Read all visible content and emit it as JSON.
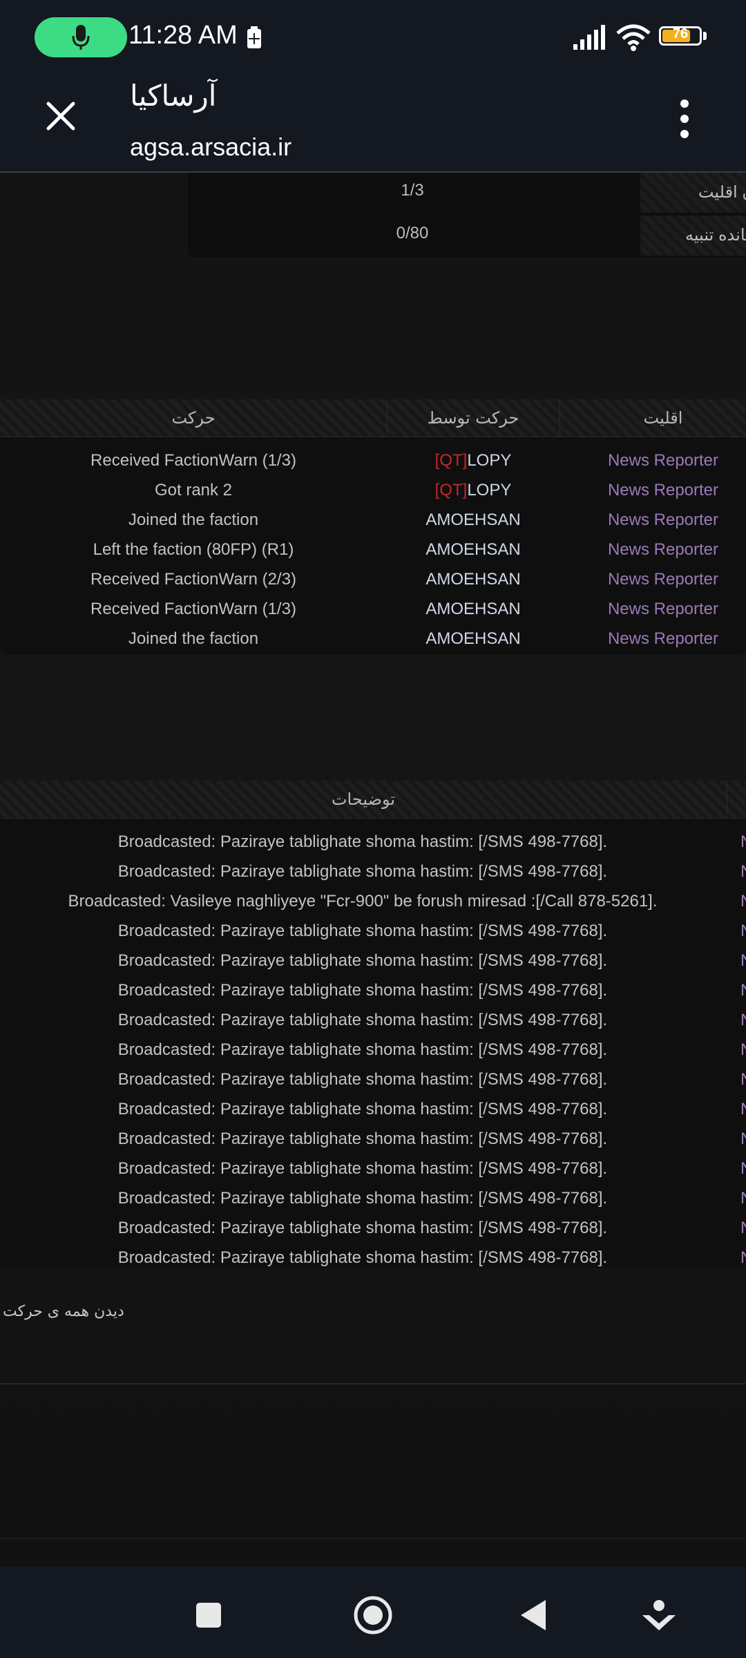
{
  "status_bar": {
    "time": "11:28 AM",
    "battery": "76",
    "battery_level_percent": 76,
    "icons": [
      "microphone-icon",
      "battery-saver-icon",
      "signal-icon",
      "wifi-icon",
      "battery-icon"
    ]
  },
  "header": {
    "title": "آرساکیا",
    "url": "agsa.arsacia.ir",
    "icons": [
      "close-icon",
      "more-vert-icon"
    ]
  },
  "info": {
    "rows": [
      {
        "label": "ن اقلیت",
        "value": "1/3"
      },
      {
        "label": "مانده تنبیه",
        "value": "0/80"
      }
    ]
  },
  "moves_table": {
    "headers": {
      "action": "حرکت",
      "by": "حرکت توسط",
      "rank": "اقلیت"
    },
    "rows": [
      {
        "action": "Received FactionWarn (1/3)",
        "by_tag": "[QT]",
        "by": "LOPY",
        "rank": "News Reporter"
      },
      {
        "action": "Got rank 2",
        "by_tag": "[QT]",
        "by": "LOPY",
        "rank": "News Reporter"
      },
      {
        "action": "Joined the faction",
        "by_tag": "",
        "by": "AMOEHSAN",
        "rank": "News Reporter"
      },
      {
        "action": "Left the faction (80FP) (R1)",
        "by_tag": "",
        "by": "AMOEHSAN",
        "rank": "News Reporter"
      },
      {
        "action": "Received FactionWarn (2/3)",
        "by_tag": "",
        "by": "AMOEHSAN",
        "rank": "News Reporter"
      },
      {
        "action": "Received FactionWarn (1/3)",
        "by_tag": "",
        "by": "AMOEHSAN",
        "rank": "News Reporter"
      },
      {
        "action": "Joined the faction",
        "by_tag": "",
        "by": "AMOEHSAN",
        "rank": "News Reporter"
      }
    ]
  },
  "desc_table": {
    "header": "توضیحات",
    "edge_text": "N",
    "rows": [
      "Broadcasted: Paziraye tablighate shoma hastim: [/SMS 498-7768].",
      "Broadcasted: Paziraye tablighate shoma hastim: [/SMS 498-7768].",
      "Broadcasted: Vasileye naghliyeye \"Fcr-900\" be forush miresad :[/Call 878-5261].",
      "Broadcasted: Paziraye tablighate shoma hastim: [/SMS 498-7768].",
      "Broadcasted: Paziraye tablighate shoma hastim: [/SMS 498-7768].",
      "Broadcasted: Paziraye tablighate shoma hastim: [/SMS 498-7768].",
      "Broadcasted: Paziraye tablighate shoma hastim: [/SMS 498-7768].",
      "Broadcasted: Paziraye tablighate shoma hastim: [/SMS 498-7768].",
      "Broadcasted: Paziraye tablighate shoma hastim: [/SMS 498-7768].",
      "Broadcasted: Paziraye tablighate shoma hastim: [/SMS 498-7768].",
      "Broadcasted: Paziraye tablighate shoma hastim: [/SMS 498-7768].",
      "Broadcasted: Paziraye tablighate shoma hastim: [/SMS 498-7768].",
      "Broadcasted: Paziraye tablighate shoma hastim: [/SMS 498-7768].",
      "Broadcasted: Paziraye tablighate shoma hastim: [/SMS 498-7768].",
      "Broadcasted: Paziraye tablighate shoma hastim: [/SMS 498-7768]."
    ]
  },
  "view_all_label": "دیدن همه ی حرکت",
  "nav_bar": {
    "icons": [
      "recents-square-icon",
      "home-circle-icon",
      "back-triangle-icon",
      "assistant-icon"
    ]
  },
  "colors": {
    "accent_green": "#3ddc84",
    "rank_purple": "#9b7ab8",
    "tag_red": "#c62828",
    "battery_orange": "#f2b01e"
  }
}
